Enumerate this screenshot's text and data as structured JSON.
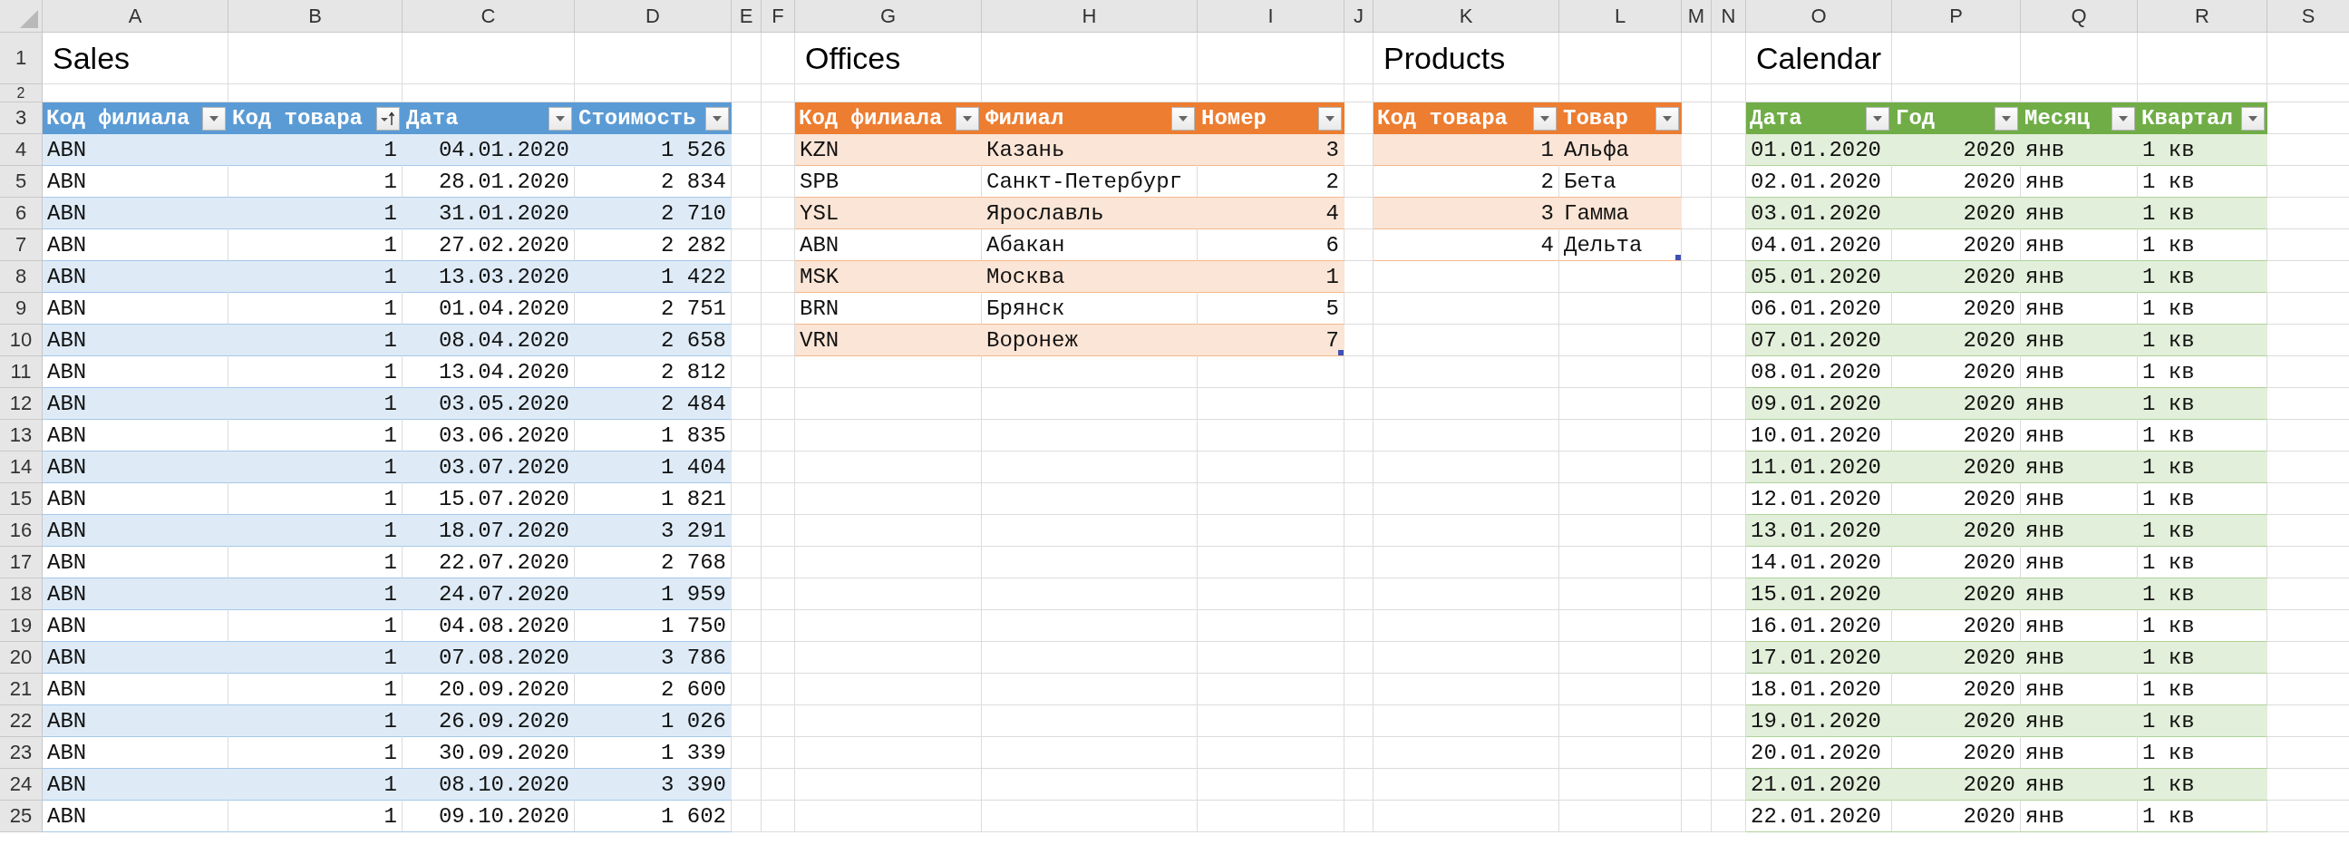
{
  "column_letters": [
    "A",
    "B",
    "C",
    "D",
    "E",
    "F",
    "G",
    "H",
    "I",
    "J",
    "K",
    "L",
    "M",
    "N",
    "O",
    "P",
    "Q",
    "R",
    "S"
  ],
  "row_numbers": [
    "1",
    "2",
    "3",
    "4",
    "5",
    "6",
    "7",
    "8",
    "9",
    "10",
    "11",
    "12",
    "13",
    "14",
    "15",
    "16",
    "17",
    "18",
    "19",
    "20",
    "21",
    "22",
    "23",
    "24",
    "25"
  ],
  "tables": [
    {
      "title": "Sales",
      "color": "#5b9bd5",
      "resize_handle": false,
      "columns": [
        {
          "label": "Код филиала",
          "numeric": false,
          "sorted": false
        },
        {
          "label": "Код товара",
          "numeric": true,
          "sorted": true
        },
        {
          "label": "Дата",
          "numeric": true,
          "sorted": false
        },
        {
          "label": "Стоимость",
          "numeric": true,
          "sorted": false
        }
      ],
      "rows": [
        [
          "ABN",
          "1",
          "04.01.2020",
          "1 526"
        ],
        [
          "ABN",
          "1",
          "28.01.2020",
          "2 834"
        ],
        [
          "ABN",
          "1",
          "31.01.2020",
          "2 710"
        ],
        [
          "ABN",
          "1",
          "27.02.2020",
          "2 282"
        ],
        [
          "ABN",
          "1",
          "13.03.2020",
          "1 422"
        ],
        [
          "ABN",
          "1",
          "01.04.2020",
          "2 751"
        ],
        [
          "ABN",
          "1",
          "08.04.2020",
          "2 658"
        ],
        [
          "ABN",
          "1",
          "13.04.2020",
          "2 812"
        ],
        [
          "ABN",
          "1",
          "03.05.2020",
          "2 484"
        ],
        [
          "ABN",
          "1",
          "03.06.2020",
          "1 835"
        ],
        [
          "ABN",
          "1",
          "03.07.2020",
          "1 404"
        ],
        [
          "ABN",
          "1",
          "15.07.2020",
          "1 821"
        ],
        [
          "ABN",
          "1",
          "18.07.2020",
          "3 291"
        ],
        [
          "ABN",
          "1",
          "22.07.2020",
          "2 768"
        ],
        [
          "ABN",
          "1",
          "24.07.2020",
          "1 959"
        ],
        [
          "ABN",
          "1",
          "04.08.2020",
          "1 750"
        ],
        [
          "ABN",
          "1",
          "07.08.2020",
          "3 786"
        ],
        [
          "ABN",
          "1",
          "20.09.2020",
          "2 600"
        ],
        [
          "ABN",
          "1",
          "26.09.2020",
          "1 026"
        ],
        [
          "ABN",
          "1",
          "30.09.2020",
          "1 339"
        ],
        [
          "ABN",
          "1",
          "08.10.2020",
          "3 390"
        ],
        [
          "ABN",
          "1",
          "09.10.2020",
          "1 602"
        ]
      ]
    },
    {
      "title": "Offices",
      "color": "#ed7d31",
      "resize_handle": true,
      "columns": [
        {
          "label": "Код филиала",
          "numeric": false,
          "sorted": false
        },
        {
          "label": "Филиал",
          "numeric": false,
          "sorted": false
        },
        {
          "label": "Номер",
          "numeric": true,
          "sorted": false
        }
      ],
      "rows": [
        [
          "KZN",
          "Казань",
          "3"
        ],
        [
          "SPB",
          "Санкт-Петербург",
          "2"
        ],
        [
          "YSL",
          "Ярославль",
          "4"
        ],
        [
          "ABN",
          "Абакан",
          "6"
        ],
        [
          "MSK",
          "Москва",
          "1"
        ],
        [
          "BRN",
          "Брянск",
          "5"
        ],
        [
          "VRN",
          "Воронеж",
          "7"
        ]
      ]
    },
    {
      "title": "Products",
      "color": "#ed7d31",
      "resize_handle": true,
      "columns": [
        {
          "label": "Код товара",
          "numeric": true,
          "sorted": false
        },
        {
          "label": "Товар",
          "numeric": false,
          "sorted": false
        }
      ],
      "rows": [
        [
          "1",
          "Альфа"
        ],
        [
          "2",
          "Бета"
        ],
        [
          "3",
          "Гамма"
        ],
        [
          "4",
          "Дельта"
        ]
      ]
    },
    {
      "title": "Calendar",
      "color": "#70ad47",
      "resize_handle": false,
      "columns": [
        {
          "label": "Дата",
          "numeric": false,
          "sorted": false
        },
        {
          "label": "Год",
          "numeric": true,
          "sorted": false
        },
        {
          "label": "Месяц",
          "numeric": false,
          "sorted": false
        },
        {
          "label": "Квартал",
          "numeric": false,
          "sorted": false
        }
      ],
      "rows": [
        [
          "01.01.2020",
          "2020",
          "янв",
          "1 кв"
        ],
        [
          "02.01.2020",
          "2020",
          "янв",
          "1 кв"
        ],
        [
          "03.01.2020",
          "2020",
          "янв",
          "1 кв"
        ],
        [
          "04.01.2020",
          "2020",
          "янв",
          "1 кв"
        ],
        [
          "05.01.2020",
          "2020",
          "янв",
          "1 кв"
        ],
        [
          "06.01.2020",
          "2020",
          "янв",
          "1 кв"
        ],
        [
          "07.01.2020",
          "2020",
          "янв",
          "1 кв"
        ],
        [
          "08.01.2020",
          "2020",
          "янв",
          "1 кв"
        ],
        [
          "09.01.2020",
          "2020",
          "янв",
          "1 кв"
        ],
        [
          "10.01.2020",
          "2020",
          "янв",
          "1 кв"
        ],
        [
          "11.01.2020",
          "2020",
          "янв",
          "1 кв"
        ],
        [
          "12.01.2020",
          "2020",
          "янв",
          "1 кв"
        ],
        [
          "13.01.2020",
          "2020",
          "янв",
          "1 кв"
        ],
        [
          "14.01.2020",
          "2020",
          "янв",
          "1 кв"
        ],
        [
          "15.01.2020",
          "2020",
          "янв",
          "1 кв"
        ],
        [
          "16.01.2020",
          "2020",
          "янв",
          "1 кв"
        ],
        [
          "17.01.2020",
          "2020",
          "янв",
          "1 кв"
        ],
        [
          "18.01.2020",
          "2020",
          "янв",
          "1 кв"
        ],
        [
          "19.01.2020",
          "2020",
          "янв",
          "1 кв"
        ],
        [
          "20.01.2020",
          "2020",
          "янв",
          "1 кв"
        ],
        [
          "21.01.2020",
          "2020",
          "янв",
          "1 кв"
        ],
        [
          "22.01.2020",
          "2020",
          "янв",
          "1 кв"
        ]
      ]
    }
  ]
}
